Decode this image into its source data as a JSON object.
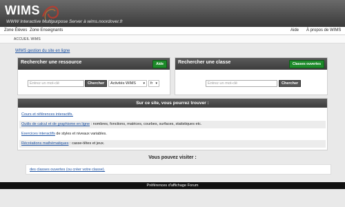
{
  "header": {
    "logo": "WIMS",
    "tagline": "WWW Interactive Multipurpose Server à wims.noordover.fr"
  },
  "topnav": {
    "left": [
      "Zone Élèves",
      "Zone Enseignants"
    ],
    "right": [
      "Aide",
      "À propos de WIMS"
    ]
  },
  "breadcrumb": "ACCUEIL WIMS",
  "gestion_link": "WIMS gestion du site en ligne",
  "resource_panel": {
    "title": "Rechercher une ressource",
    "help_button": "Aide",
    "search_placeholder": "Entrez un mot-clé",
    "search_button": "Chercher",
    "category_select": "Activités WIMS",
    "lang_select": "fr"
  },
  "class_panel": {
    "title": "Rechercher une classe",
    "open_classes_button": "Classes ouvertes",
    "search_placeholder": "Entrez un mot-clé",
    "search_button": "Chercher"
  },
  "site_section": {
    "title": "Sur ce site, vous pourrez trouver :",
    "rows": [
      {
        "link": "Cours et références interactifs.",
        "text": ""
      },
      {
        "link": "Outils de calcul et de graphisme en ligne",
        "text": " : nombres, fonctions, matrices, courbes, surfaces, statistiques etc."
      },
      {
        "link": "Exercices interactifs",
        "text": " de styles et niveaux variables."
      },
      {
        "link": "Récréations mathématiques",
        "text": " : casse-têtes et jeux."
      }
    ]
  },
  "visit": {
    "title": "Vous pouvez visiter :",
    "link": "des classes ouvertes (ou créer votre classe)."
  },
  "footer": "Préférences d'affichage Forum",
  "colors": {
    "header_dark": "#3a3a3a",
    "green_button": "#1d8a2a",
    "link_blue": "#1a4fa0",
    "logo_swirl": "#c0392b"
  }
}
